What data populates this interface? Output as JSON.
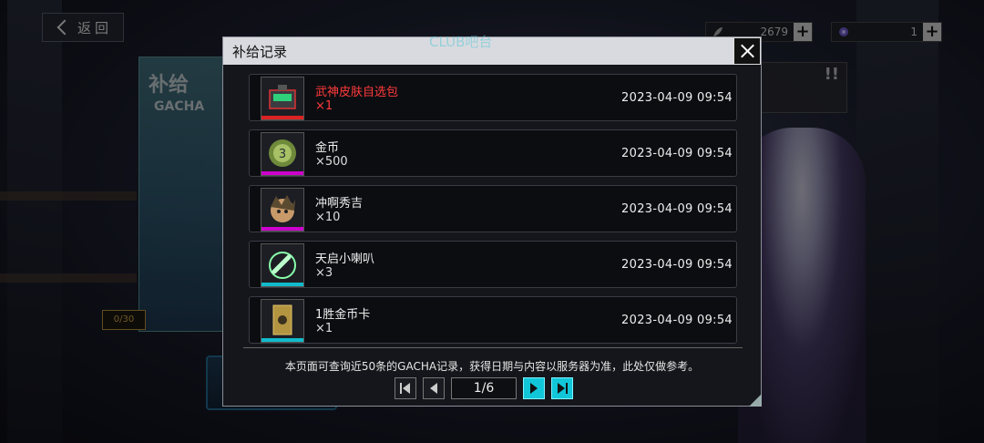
{
  "topbar": {
    "back_label": "返回",
    "resources": [
      {
        "icon": "feather-icon",
        "value": "2679"
      },
      {
        "icon": "crystal-icon",
        "value": "1"
      }
    ]
  },
  "background": {
    "banner_title": "补给",
    "banner_sub": "GACHA",
    "counter": "0/30",
    "notice_mark": "!!"
  },
  "dialog": {
    "title": "补给记录",
    "watermark": "CLUB吧台",
    "records": [
      {
        "name": "武神皮肤自选包",
        "qty": "×1",
        "time": "2023-04-09   09:54",
        "highlight": true,
        "icon": "skin-pack-icon"
      },
      {
        "name": "金币",
        "qty": "×500",
        "time": "2023-04-09   09:54",
        "highlight": false,
        "icon": "gold-coin-icon"
      },
      {
        "name": "冲啊秀吉",
        "qty": "×10",
        "time": "2023-04-09   09:54",
        "highlight": false,
        "icon": "hideyoshi-icon"
      },
      {
        "name": "天启小喇叭",
        "qty": "×3",
        "time": "2023-04-09   09:54",
        "highlight": false,
        "icon": "trumpet-icon"
      },
      {
        "name": "1胜金币卡",
        "qty": "×1",
        "time": "2023-04-09   09:54",
        "highlight": false,
        "icon": "gold-card-icon"
      }
    ],
    "note": "本页面可查询近50条的GACHA记录，获得日期与内容以服务器为准，此处仅做参考。",
    "pager": {
      "current": "1/6"
    }
  },
  "colors": {
    "highlight_text": "#ff3b3b",
    "accent": "#11c6d8"
  }
}
